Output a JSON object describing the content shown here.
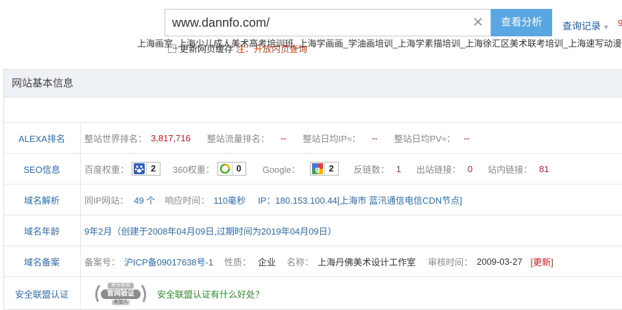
{
  "search": {
    "value": "www.dannfo.com/",
    "submit_label": "查看分析",
    "history_label": "查询记录",
    "edge_char": "9"
  },
  "cache": {
    "label": "更新网页缓存",
    "note": "注：开放内页查询"
  },
  "panel": {
    "title": "网站基本信息",
    "site_title": "上海画室_上海少儿成人美术高考培训班_上海学画画_学油画培训_上海学素描培训_上海徐汇区美术联考培训_上海速写动漫培训"
  },
  "alexa": {
    "label": "ALEXA排名",
    "world_rank_label": "整站世界排名：",
    "world_rank": "3,817,716",
    "traffic_rank_label": "整站流量排名：",
    "traffic_rank": "--",
    "daily_ip_label": "整站日均IP≈：",
    "daily_ip": "--",
    "daily_pv_label": "整站日均PV≈：",
    "daily_pv": "--"
  },
  "seo": {
    "label": "SEO信息",
    "baidu_label": "百度权重：",
    "baidu_value": "2",
    "s360_label": "360权重：",
    "s360_value": "0",
    "google_label": "Google：",
    "google_value": "2",
    "backlinks_label": "反链数：",
    "backlinks": "1",
    "outlinks_label": "出站链接：",
    "outlinks": "0",
    "inlinks_label": "站内链接：",
    "inlinks": "81"
  },
  "dns": {
    "label": "域名解析",
    "same_ip_label": "同IP网站：",
    "same_ip": "49 个",
    "response_label": "响应时间：",
    "response": "110毫秒",
    "ip_text": "IP：180.153.100.44[上海市 蓝汛通信电信CDN节点]"
  },
  "age": {
    "label": "域名年龄",
    "value": "9年2月（创建于2008年04月09日,过期时间为2019年04月09日）"
  },
  "icp": {
    "label": "域名备案",
    "number_label": "备案号：",
    "number": "沪ICP备09017638号-1",
    "nature_label": "性质：",
    "nature": "企业",
    "name_label": "名称：",
    "name": "上海丹佛美术设计工作室",
    "audit_label": "审核时间：",
    "audit": "2009-03-27",
    "refresh": "[更新]"
  },
  "security": {
    "label": "安全联盟认证",
    "seal_top": "安全联盟",
    "seal_main": "官网验证",
    "seal_bottom": "未加入",
    "link": "安全联盟认证有什么好处？"
  },
  "colors": {
    "button": "#5aa6e3",
    "link_blue": "#2b6cb0",
    "value_red": "#d0161d",
    "note_orange": "#d83b0d",
    "header_bg": "#eef1f5"
  }
}
